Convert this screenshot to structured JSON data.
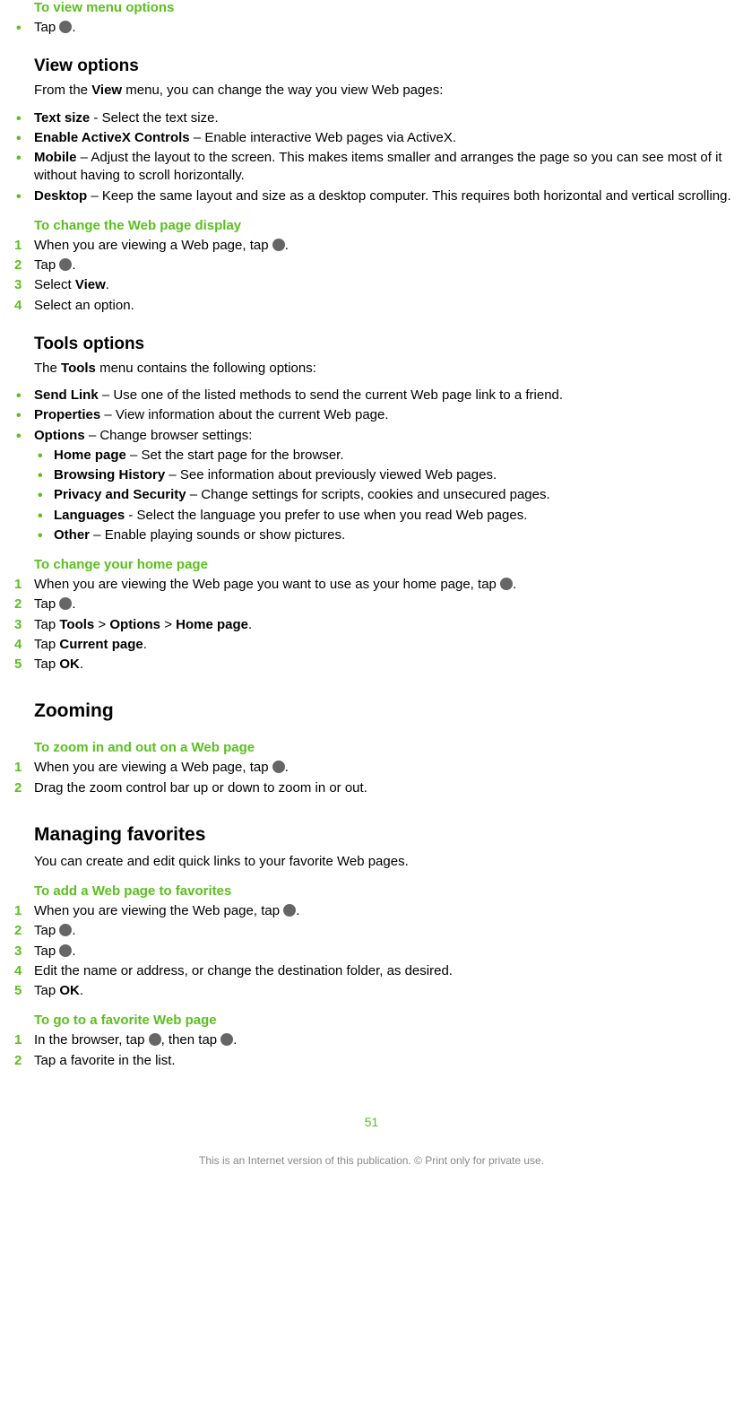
{
  "sections": {
    "viewMenuOptions": {
      "heading": "To view menu options",
      "bullet": {
        "pre": "Tap ",
        "post": "."
      }
    },
    "viewOptions": {
      "heading": "View options",
      "intro_pre": "From the ",
      "intro_bold": "View",
      "intro_post": " menu, you can change the way you view Web pages:",
      "items": [
        {
          "bold": "Text size",
          "text": " - Select the text size."
        },
        {
          "bold": "Enable ActiveX Controls",
          "text": " – Enable interactive Web pages via ActiveX."
        },
        {
          "bold": "Mobile",
          "text": " – Adjust the layout to the screen. This makes items smaller and arranges the page so you can see most of it without having to scroll horizontally."
        },
        {
          "bold": "Desktop",
          "text": " – Keep the same layout and size as a desktop computer. This requires both horizontal and vertical scrolling."
        }
      ]
    },
    "changeDisplay": {
      "heading": "To change the Web page display",
      "steps": [
        {
          "pre": "When you are viewing a Web page, tap ",
          "icon": true,
          "post": "."
        },
        {
          "pre": "Tap ",
          "icon": true,
          "post": "."
        },
        {
          "pre": "Select ",
          "bold": "View",
          "post": "."
        },
        {
          "pre": "Select an option."
        }
      ]
    },
    "toolsOptions": {
      "heading": "Tools options",
      "intro_pre": "The ",
      "intro_bold": "Tools",
      "intro_post": " menu contains the following options:",
      "items": [
        {
          "bold": "Send Link",
          "text": " – Use one of the listed methods to send the current Web page link to a friend."
        },
        {
          "bold": "Properties",
          "text": " – View information about the current Web page."
        },
        {
          "bold": "Options",
          "text": " – Change browser settings:"
        }
      ],
      "subitems": [
        {
          "bold": "Home page",
          "text": " – Set the start page for the browser."
        },
        {
          "bold": "Browsing History",
          "text": " – See information about previously viewed Web pages."
        },
        {
          "bold": "Privacy and Security",
          "text": " – Change settings for scripts, cookies and unsecured pages."
        },
        {
          "bold": "Languages",
          "text": " - Select the language you prefer to use when you read Web pages."
        },
        {
          "bold": "Other",
          "text": " – Enable playing sounds or show pictures."
        }
      ]
    },
    "changeHome": {
      "heading": "To change your home page",
      "steps": [
        {
          "pre": "When you are viewing the Web page you want to use as your home page, tap ",
          "icon": true,
          "post": "."
        },
        {
          "pre": "Tap ",
          "icon": true,
          "post": "."
        },
        {
          "pre": "Tap ",
          "bold": "Tools",
          "mid1": " > ",
          "bold2": "Options",
          "mid2": " > ",
          "bold3": "Home page",
          "post": "."
        },
        {
          "pre": "Tap ",
          "bold": "Current page",
          "post": "."
        },
        {
          "pre": "Tap ",
          "bold": "OK",
          "post": "."
        }
      ]
    },
    "zooming": {
      "heading": "Zooming",
      "subheading": "To zoom in and out on a Web page",
      "steps": [
        {
          "pre": "When you are viewing a Web page, tap ",
          "icon": true,
          "post": "."
        },
        {
          "pre": "Drag the zoom control bar up or down to zoom in or out."
        }
      ]
    },
    "favorites": {
      "heading": "Managing favorites",
      "intro": "You can create and edit quick links to your favorite Web pages.",
      "addHeading": "To add a Web page to favorites",
      "addSteps": [
        {
          "pre": "When you are viewing the Web page, tap ",
          "icon": true,
          "post": "."
        },
        {
          "pre": "Tap ",
          "icon": true,
          "post": "."
        },
        {
          "pre": "Tap ",
          "icon": true,
          "post": "."
        },
        {
          "pre": "Edit the name or address, or change the destination folder, as desired."
        },
        {
          "pre": "Tap ",
          "bold": "OK",
          "post": "."
        }
      ],
      "goHeading": "To go to a favorite Web page",
      "goSteps": [
        {
          "pre": "In the browser, tap ",
          "icon": true,
          "mid": ", then tap ",
          "icon2": true,
          "post": "."
        },
        {
          "pre": "Tap a favorite in the list."
        }
      ]
    }
  },
  "footer": {
    "pageNum": "51",
    "note": "This is an Internet version of this publication. © Print only for private use."
  }
}
